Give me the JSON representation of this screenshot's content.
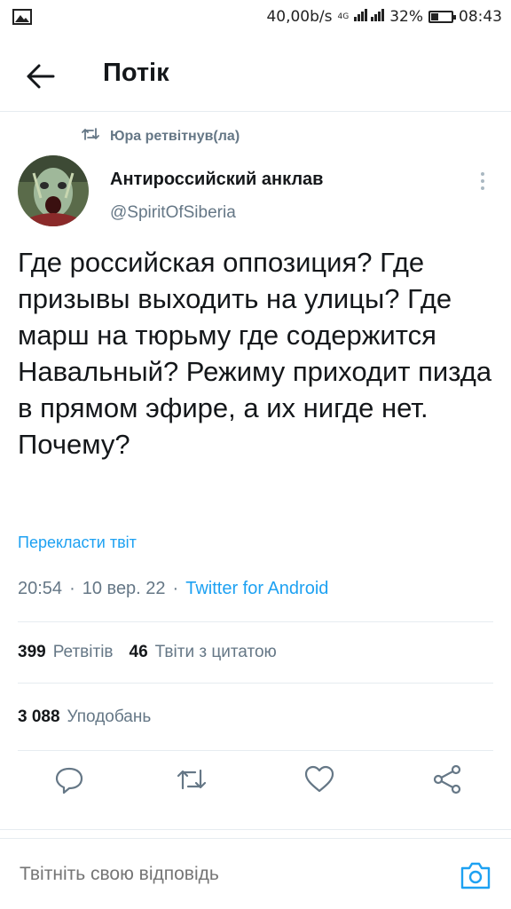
{
  "status_bar": {
    "speed": "40,00b/s",
    "network": "4G",
    "battery_text": "32%",
    "battery_level": 0.32,
    "time": "08:43"
  },
  "header": {
    "title": "Потік"
  },
  "retweet": {
    "text": "Юра ретвітнув(ла)"
  },
  "author": {
    "name": "Антироссийский анклав",
    "handle": "@SpiritOfSiberia"
  },
  "tweet": {
    "text": "Где российская оппозиция? Где призывы выходить на улицы? Где марш на тюрьму где содержится Навальный? Режиму приходит пизда в прямом эфире, а их нигде нет. Почему?",
    "translate_label": "Перекласти твіт",
    "time": "20:54",
    "sep1": "·",
    "date": "10 вер. 22",
    "sep2": "·",
    "source": "Twitter for Android"
  },
  "stats": {
    "retweets_count": "399",
    "retweets_label": "Ретвітів",
    "quotes_count": "46",
    "quotes_label": "Твіти з цитатою",
    "likes_count": "3 088",
    "likes_label": "Уподобань"
  },
  "reply": {
    "placeholder": "Твітніть свою відповідь"
  },
  "colors": {
    "accent": "#1da1f2",
    "secondary_text": "#657786",
    "divider": "#e6ecf0"
  },
  "icons": {
    "back": "arrow-left-icon",
    "retweet": "retweet-icon",
    "more": "more-vertical-icon",
    "reply": "reply-icon",
    "like": "heart-icon",
    "share": "share-icon",
    "camera": "camera-icon"
  }
}
